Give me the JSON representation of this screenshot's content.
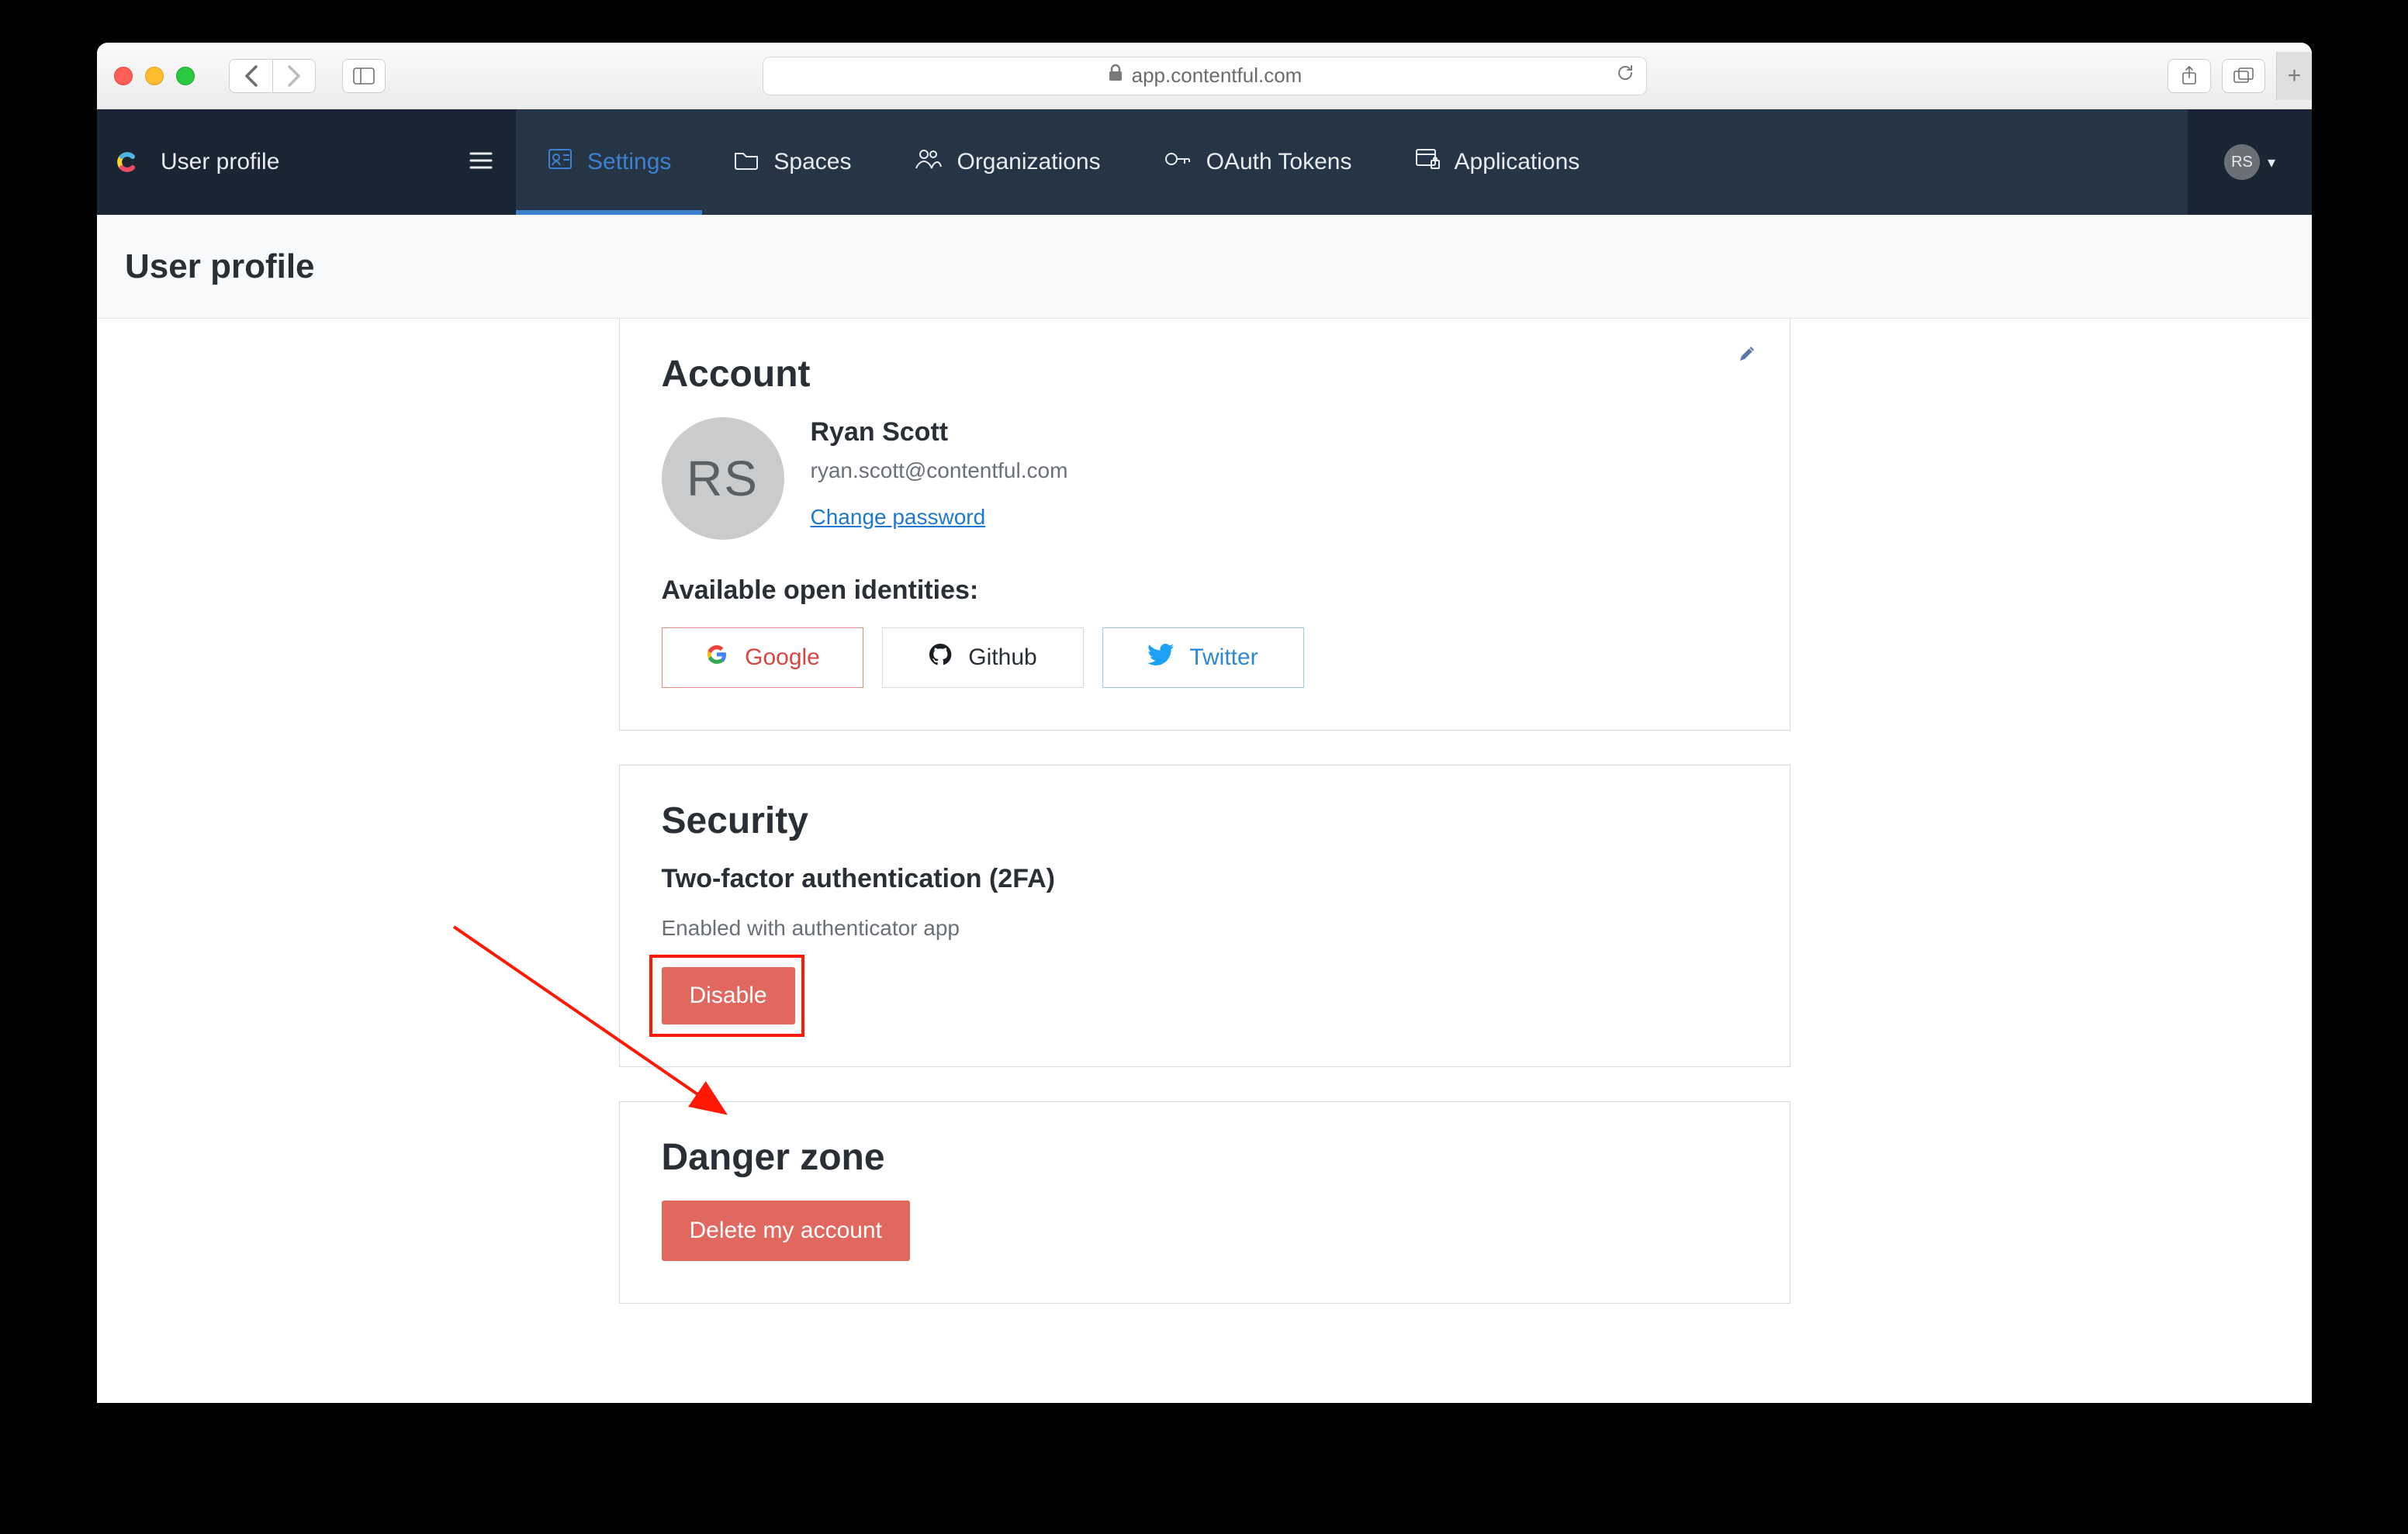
{
  "browser": {
    "url_host": "app.contentful.com"
  },
  "nav": {
    "brand_label": "User profile",
    "tabs": [
      {
        "id": "settings",
        "label": "Settings",
        "active": true
      },
      {
        "id": "spaces",
        "label": "Spaces"
      },
      {
        "id": "organizations",
        "label": "Organizations"
      },
      {
        "id": "oauth",
        "label": "OAuth Tokens"
      },
      {
        "id": "applications",
        "label": "Applications"
      }
    ],
    "user_initials": "RS"
  },
  "page": {
    "title": "User profile"
  },
  "account": {
    "heading": "Account",
    "avatar_initials": "RS",
    "name": "Ryan Scott",
    "email": "ryan.scott@contentful.com",
    "change_password_label": "Change password",
    "identities_heading": "Available open identities:",
    "identities": {
      "google": "Google",
      "github": "Github",
      "twitter": "Twitter"
    }
  },
  "security": {
    "heading": "Security",
    "subheading": "Two-factor authentication (2FA)",
    "status": "Enabled with authenticator app",
    "disable_label": "Disable"
  },
  "danger": {
    "heading": "Danger zone",
    "delete_label": "Delete my account"
  }
}
